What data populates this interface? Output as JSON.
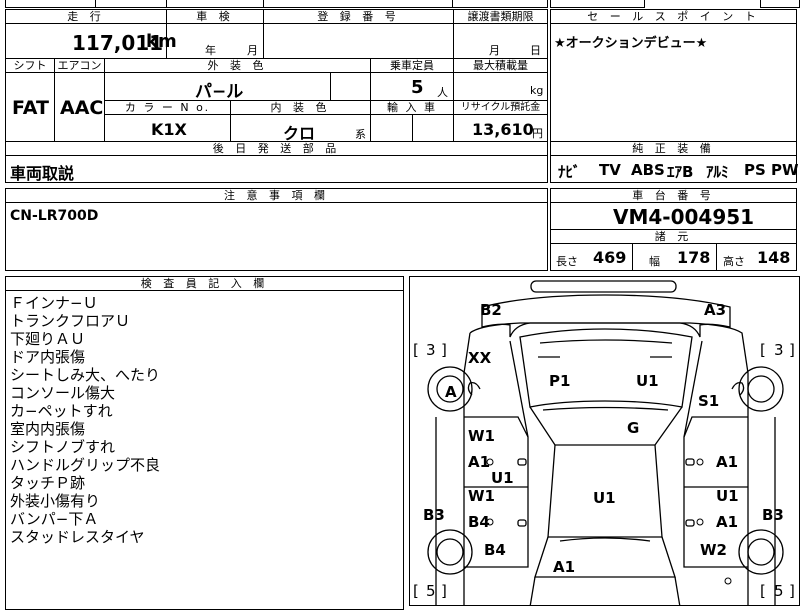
{
  "top_fragment": "",
  "sheet": {
    "mileage": {
      "header": "走 行",
      "value": "117,011",
      "unit": "km"
    },
    "inspection": {
      "header": "車 検",
      "year_label": "年",
      "month_label": "月"
    },
    "registration": {
      "header": "登 録 番 号"
    },
    "transfer_deadline": {
      "header": "譲渡書類期限",
      "month_label": "月",
      "day_label": "日"
    },
    "shift": {
      "header": "シフト",
      "value": "FAT"
    },
    "aircon": {
      "header": "エアコン",
      "value": "AAC"
    },
    "exterior_color": {
      "header": "外 装 色",
      "value": "パ−ル"
    },
    "capacity": {
      "header": "乗車定員",
      "value": "5",
      "unit": "人"
    },
    "max_load": {
      "header": "最大積載量",
      "unit": "kg"
    },
    "color_no": {
      "header": "カ ラ ー N o.",
      "value": "K1X"
    },
    "interior_color": {
      "header": "内 装 色",
      "value": "クロ",
      "suffix": "系"
    },
    "import": {
      "header": "輸 入 車"
    },
    "recycle": {
      "header": "リサイクル預託金",
      "value": "13,610",
      "unit": "円"
    },
    "later_parts": {
      "header": "後 日 発 送 部 品",
      "value": "車両取説"
    },
    "notes_field": {
      "header": "注 意 事 項 欄",
      "value": "CN-LR700D"
    }
  },
  "sales_point": {
    "header": "セ ー ル ス ポ イ ン ト",
    "value": "★オークションデビュー★"
  },
  "equipment": {
    "header": "純 正 装 備",
    "items": [
      "ﾅﾋﾞ",
      "TV",
      "ABS",
      "ｴｱB",
      "ｱﾙﾐ",
      "PS",
      "PW"
    ]
  },
  "chassis": {
    "header": "車 台 番 号",
    "value": "VM4-004951"
  },
  "specs": {
    "header": "諸 元",
    "length_label": "長さ",
    "length": "469",
    "width_label": "幅",
    "width": "178",
    "height_label": "高さ",
    "height": "148"
  },
  "inspector": {
    "header": "検 査 員 記 入 欄",
    "lines": [
      "Ｆインナ−Ｕ",
      "トランクフロアＵ",
      "下廻りＡＵ",
      "ドア内張傷",
      "シートしみ大、へたり",
      "コンソール傷大",
      "カ−ペットすれ",
      "室内内張傷",
      "シフトノブすれ",
      "ハンドルグリップ不良",
      "タッチＰ跡",
      "外装小傷有り",
      "バンパ−下Ａ",
      "スタッドレスタイヤ"
    ]
  },
  "diagram": {
    "tire_top_left": "3",
    "tire_top_right": "3",
    "tire_bottom_left": "5",
    "tire_bottom_right": "5",
    "bracket_open": "[",
    "bracket_close": "]",
    "marks": {
      "b2": "B2",
      "a3": "A3",
      "xx": "XX",
      "a_front": "A",
      "p1": "P1",
      "u1_hood": "U1",
      "s1": "S1",
      "g": "G",
      "w1_left_front": "W1",
      "a1_left_front": "A1",
      "u1_left_mid": "U1",
      "a1_right_front": "A1",
      "w1_left_rear": "W1",
      "u1_roof": "U1",
      "u1_right_rear": "U1",
      "b3_left": "B3",
      "b4_left_door": "B4",
      "a1_right_rear": "A1",
      "b3_right": "B3",
      "b4_rear_left": "B4",
      "w2": "W2",
      "a1_trunk": "A1"
    }
  }
}
